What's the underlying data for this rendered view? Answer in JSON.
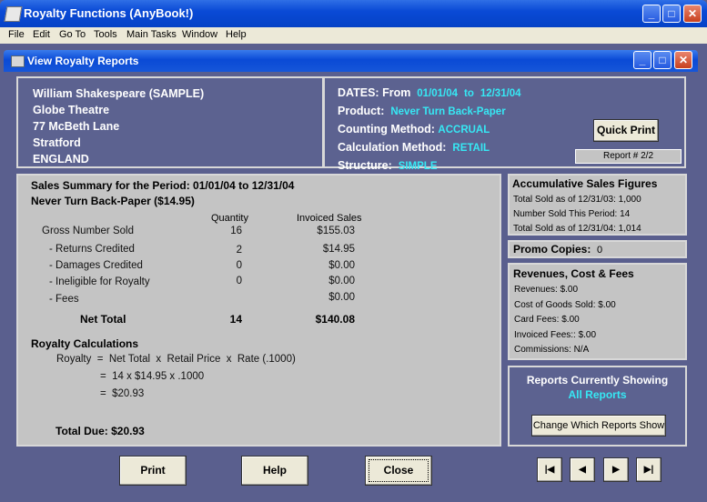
{
  "app": {
    "title": "Royalty Functions (AnyBook!)"
  },
  "menu": [
    "File",
    "Edit",
    "Go To",
    "Tools",
    "Main Tasks",
    "Window",
    "Help"
  ],
  "window": {
    "title": "View Royalty Reports"
  },
  "author": {
    "lines": [
      "William Shakespeare (SAMPLE)",
      "Globe Theatre",
      "77 McBeth Lane",
      "Stratford",
      "ENGLAND"
    ]
  },
  "info": {
    "dates_label": "DATES:  From",
    "date_from": "01/01/04",
    "to_label": "to",
    "date_to": "12/31/04",
    "product_label": "Product:",
    "product": "Never Turn Back-Paper",
    "counting_label": "Counting Method:",
    "counting": "ACCRUAL",
    "calc_label": "Calculation Method:",
    "calc": "RETAIL",
    "structure_label": "Structure:",
    "structure": "SIMPLE",
    "quick_print": "Quick Print",
    "report_num": "Report # 2/2"
  },
  "summary": {
    "title": "Sales Summary for the Period:  01/01/04 to 12/31/04",
    "product": "Never Turn Back-Paper ($14.95)",
    "col_qty": "Quantity",
    "col_sales": "Invoiced Sales",
    "rows": [
      {
        "label": "Gross Number Sold",
        "qty": "16",
        "sales": "$155.03"
      },
      {
        "label": "- Returns Credited",
        "qty": "2",
        "sales": "$14.95"
      },
      {
        "label": "- Damages Credited",
        "qty": "0",
        "sales": "$0.00"
      },
      {
        "label": "- Ineligible for Royalty",
        "qty": "0",
        "sales": "$0.00"
      },
      {
        "label": "- Fees",
        "qty": "",
        "sales": "$0.00"
      }
    ],
    "net_label": "Net Total",
    "net_qty": "14",
    "net_sales": "$140.08",
    "royalty_title": "Royalty Calculations",
    "formula1": "Royalty  =  Net Total  x  Retail Price  x  Rate (.1000)",
    "formula2": "=  14 x $14.95 x .1000",
    "formula3": "=  $20.93",
    "total_due": "Total Due: $20.93"
  },
  "accum": {
    "title": "Accumulative Sales Figures",
    "lines": [
      "Total Sold as of 12/31/03: 1,000",
      "Number Sold This Period: 14",
      "Total Sold as of 12/31/04: 1,014"
    ]
  },
  "promo": {
    "label": "Promo Copies:",
    "value": "0"
  },
  "revenues": {
    "title": "Revenues, Cost & Fees",
    "lines": [
      "Revenues: $.00",
      "Cost of Goods Sold: $.00",
      "Card Fees: $.00",
      "Invoiced Fees:: $.00",
      "Commissions: N/A"
    ]
  },
  "reports": {
    "title": "Reports Currently Showing",
    "value": "All Reports",
    "button": "Change Which Reports Show"
  },
  "buttons": {
    "print": "Print",
    "help": "Help",
    "close": "Close"
  },
  "nav": {
    "first": "|◀",
    "prev": "◀",
    "next": "▶",
    "last": "▶|"
  }
}
